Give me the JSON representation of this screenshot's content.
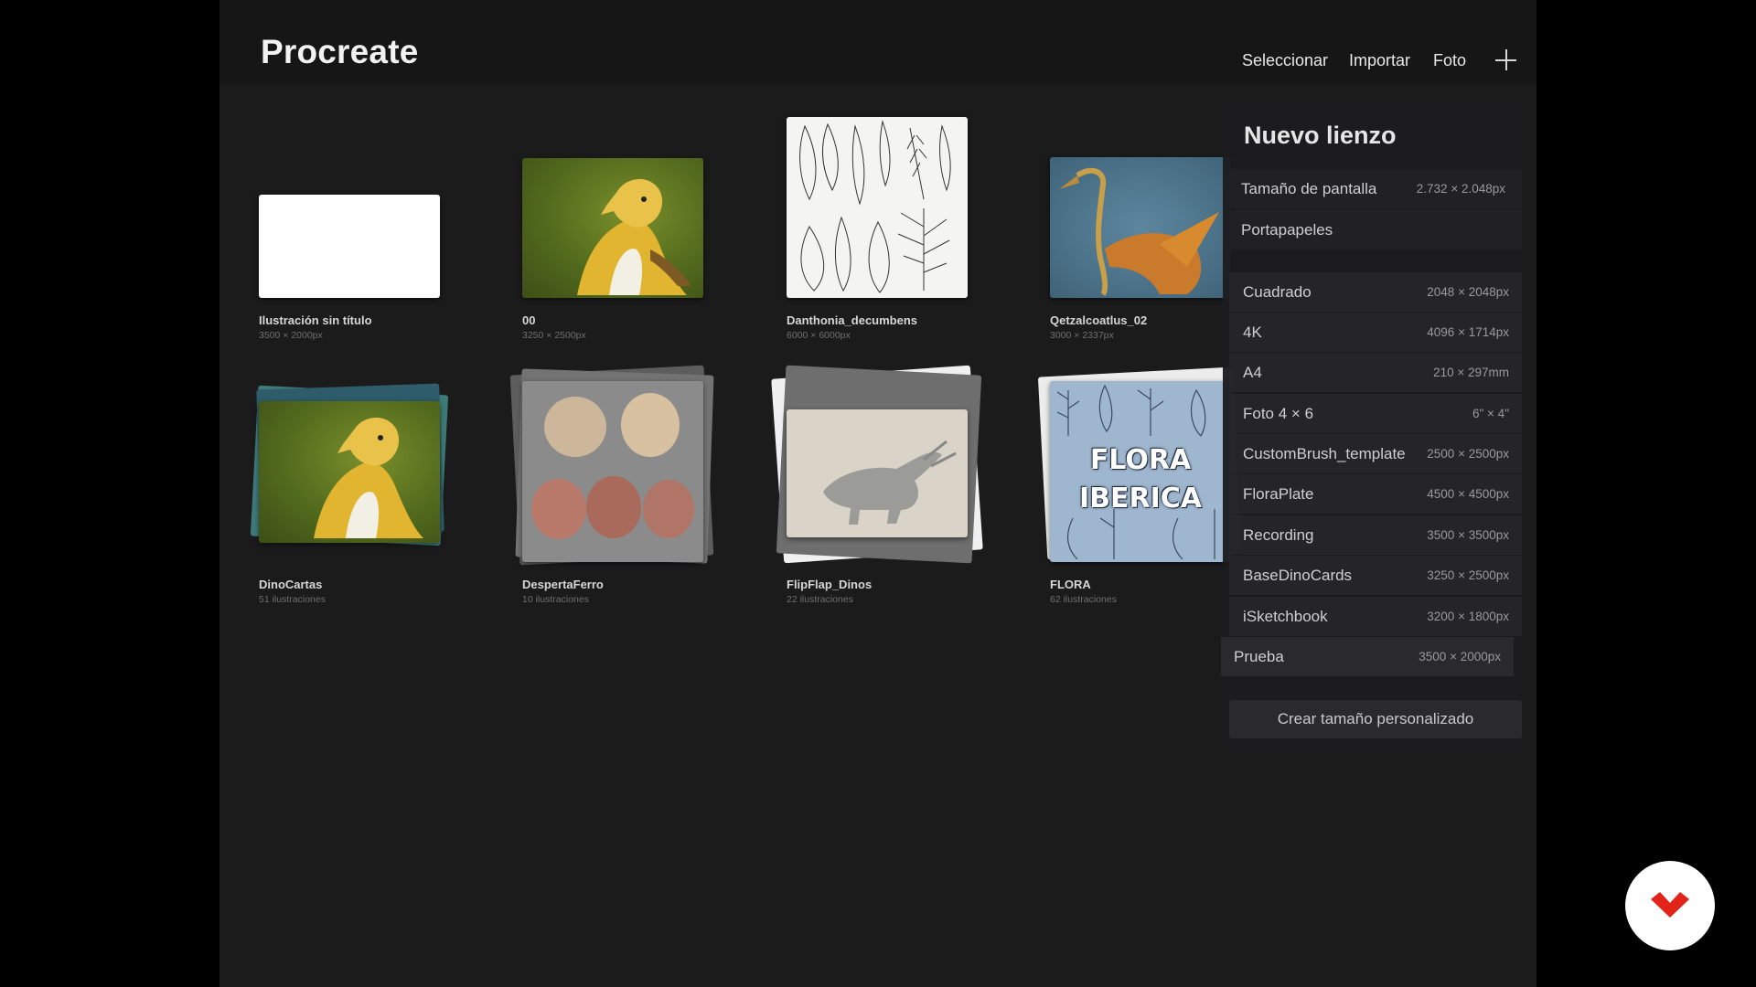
{
  "app": {
    "title": "Procreate"
  },
  "toolbar": {
    "select_label": "Seleccionar",
    "import_label": "Importar",
    "photo_label": "Foto",
    "new_icon": "plus-icon"
  },
  "gallery": {
    "items": [
      {
        "title": "Ilustración sin título",
        "subtitle": "3500 × 2000px"
      },
      {
        "title": "00",
        "subtitle": "3250 × 2500px"
      },
      {
        "title": "Danthonia_decumbens",
        "subtitle": "6000 × 6000px"
      },
      {
        "title": "Qetzalcoatlus_02",
        "subtitle": "3000 × 2337px"
      },
      {
        "title": "DinoCartas",
        "subtitle": "51 ilustraciones"
      },
      {
        "title": "DespertaFerro",
        "subtitle": "10 ilustraciones"
      },
      {
        "title": "FlipFlap_Dinos",
        "subtitle": "22 ilustraciones"
      },
      {
        "title": "FLORA",
        "subtitle": "62 ilustraciones"
      }
    ],
    "flora_cover_text": "FLORA IBERICA"
  },
  "canvas_panel": {
    "title": "Nuevo lienzo",
    "screen_size": {
      "label": "Tamaño de pantalla",
      "dims": "2.732 × 2.048px"
    },
    "clipboard": {
      "label": "Portapapeles"
    },
    "presets": [
      {
        "name": "Cuadrado",
        "dims": "2048 × 2048px"
      },
      {
        "name": "4K",
        "dims": "4096 × 1714px"
      },
      {
        "name": "A4",
        "dims": "210 × 297mm"
      },
      {
        "name": "Foto 4 × 6",
        "dims": "6\" × 4\""
      },
      {
        "name": "CustomBrush_template",
        "dims": "2500 × 2500px"
      },
      {
        "name": "FloraPlate",
        "dims": "4500 × 4500px"
      },
      {
        "name": "Recording",
        "dims": "3500 × 3500px"
      },
      {
        "name": "BaseDinoCards",
        "dims": "3250 × 2500px"
      },
      {
        "name": "iSketchbook",
        "dims": "3200 × 1800px"
      },
      {
        "name": "Prueba",
        "dims": "3500 × 2000px"
      }
    ],
    "custom_label": "Crear tamaño personalizado"
  },
  "colors": {
    "background": "#1b1b1c",
    "topbar": "#161616",
    "logo_red": "#e2231a"
  }
}
